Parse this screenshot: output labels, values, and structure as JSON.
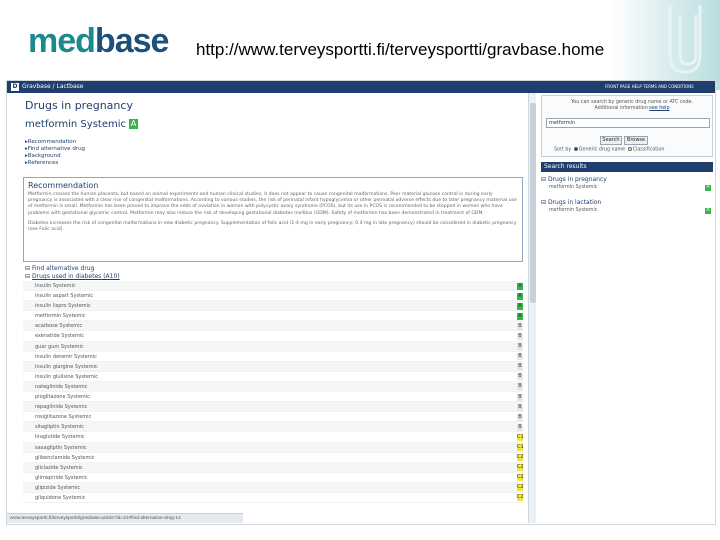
{
  "slide": {
    "logo_part1": "med",
    "logo_part2": "base",
    "url": "http://www.terveysportti.fi/terveysportti/gravbase.home"
  },
  "browser": {
    "top_bar_title": "Gravbase / Lactbase",
    "top_bar_links": "FRONT PAGE  HELP  TERMS AND CONDITIONS",
    "status_url": "www.terveysportti.fi/terveysportti/gravbase.article?id=31#find-alternative-drug-14"
  },
  "main": {
    "heading": "Drugs in pregnancy",
    "drug_name": "metformin Systemic",
    "drug_class": "A",
    "nav_links": [
      "Recommendation",
      "Find alternative drug",
      "Background",
      "References"
    ],
    "recommendation_title": "Recommendation",
    "recommendation_p1": "Metformin crosses the human placenta, but based on animal experiments and human clinical studies, it does not appear to cause congenital malformations. Peer material glucose control in during early pregnancy is associated with a clear rise of congenital malformations. According to various studies, the risk of perinatal infant hypoglycemia or other perinatal adverse effects due to later pregnancy maternal use of metformin is small. Metformin has been proved to improve the odds of ovulation in women with polycystic ovary syndrome (PCOS), but its use in PCOS is recommended to be stopped in women who have problems with gestational glycemic control. Metformin may also reduce the risk of developing gestational diabetes mellitus (GDM). Safety of metformin has been demonstrated in treatment of GDM.",
    "recommendation_p2": "Diabetes increases the risk of congenital malformations in new diabetic pregnancy. Supplementation of folic acid (1-4 mg in early pregnancy; 0.4 mg in late pregnancy) should be considered in diabetic pregnancy (see Folic acid).",
    "alt_heading": "Find alternative drug",
    "alt_subheading": "Drugs used in diabetes (A10)",
    "drugs": [
      {
        "name": "insulin Systemic",
        "cls": "A",
        "color": "#35b64b"
      },
      {
        "name": "insulin aspart Systemic",
        "cls": "A",
        "color": "#35b64b"
      },
      {
        "name": "insulin lispro Systemic",
        "cls": "A",
        "color": "#35b64b"
      },
      {
        "name": "metformin Systemic",
        "cls": "A",
        "color": "#35b64b"
      },
      {
        "name": "acarbose Systemic",
        "cls": "B",
        "color": "#e6e6e6"
      },
      {
        "name": "exenatide Systemic",
        "cls": "B",
        "color": "#e6e6e6"
      },
      {
        "name": "guar gum Systemic",
        "cls": "B",
        "color": "#e6e6e6"
      },
      {
        "name": "insulin detemir Systemic",
        "cls": "B",
        "color": "#e6e6e6"
      },
      {
        "name": "insulin glargine Systemic",
        "cls": "B",
        "color": "#e6e6e6"
      },
      {
        "name": "insulin glulisine Systemic",
        "cls": "B",
        "color": "#e6e6e6"
      },
      {
        "name": "nateglinide Systemic",
        "cls": "B",
        "color": "#e6e6e6"
      },
      {
        "name": "pioglitazone Systemic",
        "cls": "B",
        "color": "#e6e6e6"
      },
      {
        "name": "repaglinide Systemic",
        "cls": "B",
        "color": "#e6e6e6"
      },
      {
        "name": "rosiglitazone Systemic",
        "cls": "B",
        "color": "#e6e6e6"
      },
      {
        "name": "sitagliptin Systemic",
        "cls": "B",
        "color": "#e6e6e6"
      },
      {
        "name": "liraglutide Systemic",
        "cls": "C1",
        "color": "#f2e24a"
      },
      {
        "name": "saxagliptin Systemic",
        "cls": "C1",
        "color": "#f2e24a"
      },
      {
        "name": "glibenclamide Systemic",
        "cls": "C2",
        "color": "#f2e24a"
      },
      {
        "name": "gliclazide Systemic",
        "cls": "C2",
        "color": "#f2e24a"
      },
      {
        "name": "glimepiride Systemic",
        "cls": "C2",
        "color": "#f2e24a"
      },
      {
        "name": "glipizide Systemic",
        "cls": "C2",
        "color": "#f2e24a"
      },
      {
        "name": "gliquidone Systemic",
        "cls": "C2",
        "color": "#f2e24a"
      }
    ]
  },
  "sidebar": {
    "search_hint": "You can search by generic drug name or ATC code.",
    "search_hint2": "Additional information",
    "search_hint_link": "see help",
    "search_value": "metformin",
    "search_button": "Search",
    "browse_button": "Browse",
    "sort_label": "Sort by",
    "sort_opt1": "Generic drug name",
    "sort_opt2": "Classification",
    "results_heading": "Search results",
    "pregnancy_heading": "Drugs in pregnancy",
    "pregnancy_item": "metformin Systemic",
    "pregnancy_cls": "A",
    "lactation_heading": "Drugs in lactation",
    "lactation_item": "metformin Systemic",
    "lactation_cls": "A"
  }
}
